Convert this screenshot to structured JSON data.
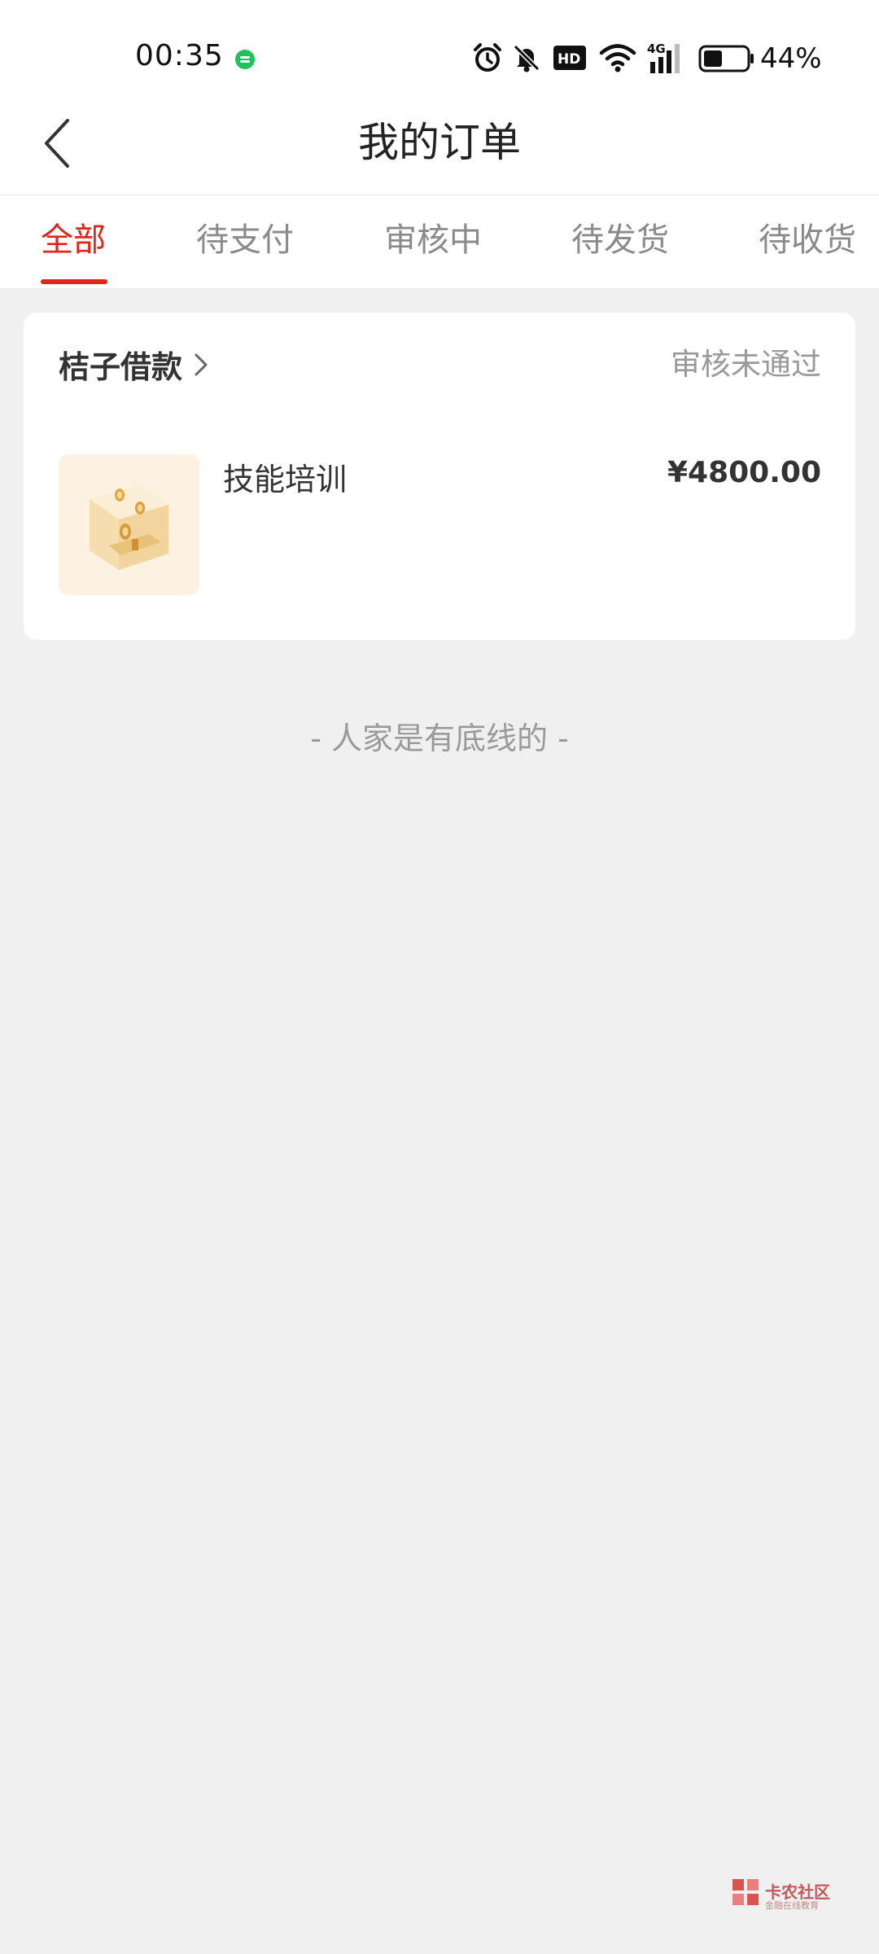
{
  "status_bar": {
    "time": "00:35",
    "battery_percent": "44%",
    "icons": [
      "wechat-notification-icon",
      "alarm-icon",
      "mute-bell-icon",
      "hd-icon",
      "wifi-icon",
      "4g-signal-icon",
      "battery-icon"
    ],
    "battery_level": 0.44
  },
  "header": {
    "title": "我的订单",
    "back_icon": "chevron-left-icon"
  },
  "tabs": [
    {
      "label": "全部",
      "active": true
    },
    {
      "label": "待支付",
      "active": false
    },
    {
      "label": "审核中",
      "active": false
    },
    {
      "label": "待发货",
      "active": false
    },
    {
      "label": "待收货",
      "active": false
    }
  ],
  "orders": [
    {
      "merchant": "桔子借款",
      "status": "审核未通过",
      "product_name": "技能培训",
      "price": "¥4800.00",
      "thumb_icon": "gold-coins-box-icon"
    }
  ],
  "footer_text": "- 人家是有底线的 -",
  "watermark": {
    "text": "卡农社区",
    "sub": "金融在线教育"
  },
  "colors": {
    "accent": "#e1251b",
    "background": "#f0f0f0",
    "card": "#ffffff",
    "muted_text": "#999999"
  }
}
